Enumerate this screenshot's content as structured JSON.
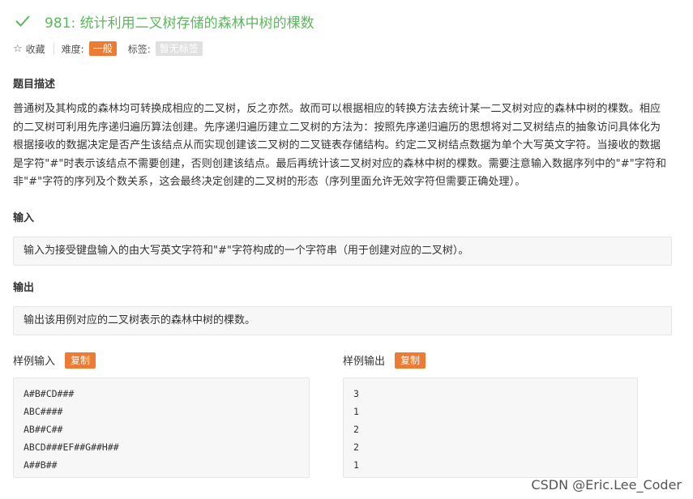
{
  "header": {
    "check_icon": "checkmark-icon",
    "title": "981: 统计利用二叉树存储的森林中树的棵数",
    "title_color": "#5cb85c"
  },
  "meta": {
    "star_icon": "star-outline-icon",
    "favorite_label": "收藏",
    "difficulty_label": "难度:",
    "difficulty_value": "一般",
    "tags_label": "标签:",
    "tags_value": "暂无标签",
    "accent_color": "#ee7b33"
  },
  "description": {
    "title": "题目描述",
    "text": "普通树及其构成的森林均可转换成相应的二叉树，反之亦然。故而可以根据相应的转换方法去统计某一二叉树对应的森林中树的棵数。相应的二叉树可利用先序递归遍历算法创建。先序递归遍历建立二叉树的方法为：按照先序递归遍历的思想将对二叉树结点的抽象访问具体化为根据接收的数据决定是否产生该结点从而实现创建该二叉树的二叉链表存储结构。约定二叉树结点数据为单个大写英文字符。当接收的数据是字符\"#\"时表示该结点不需要创建，否则创建该结点。最后再统计该二叉树对应的森林中树的棵数。需要注意输入数据序列中的\"#\"字符和非\"#\"字符的序列及个数关系，这会最终决定创建的二叉树的形态（序列里面允许无效字符但需要正确处理）。"
  },
  "input_section": {
    "title": "输入",
    "text": "输入为接受键盘输入的由大写英文字符和\"#\"字符构成的一个字符串（用于创建对应的二叉树）。"
  },
  "output_section": {
    "title": "输出",
    "text": "输出该用例对应的二叉树表示的森林中树的棵数。"
  },
  "sample_input": {
    "title": "样例输入",
    "copy_label": "复制",
    "lines": [
      "A#B#CD###",
      "ABC####",
      "AB##C##",
      "ABCD###EF##G##H##",
      "A##B##"
    ]
  },
  "sample_output": {
    "title": "样例输出",
    "copy_label": "复制",
    "lines": [
      "3",
      "1",
      "2",
      "2",
      "1"
    ]
  },
  "watermark": "CSDN @Eric.Lee_Coder"
}
